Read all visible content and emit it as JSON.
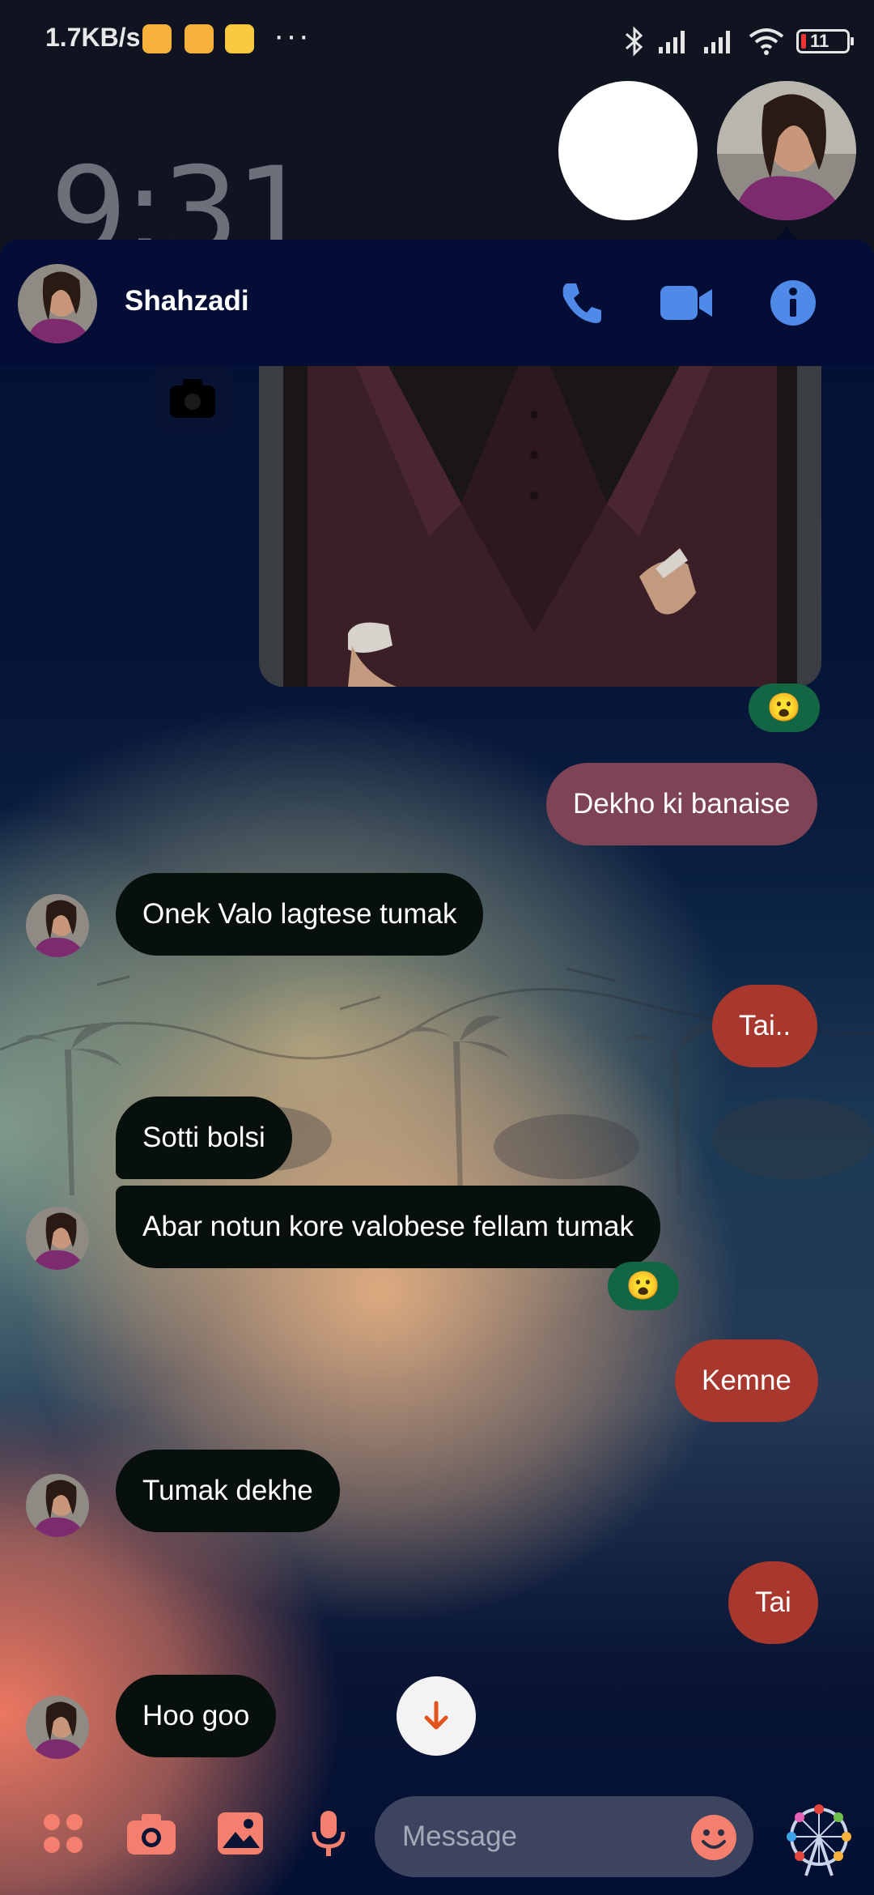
{
  "status_bar": {
    "net_speed": "1.7KB/s",
    "more": "···",
    "battery": "11"
  },
  "lock_screen": {
    "time": "9:31"
  },
  "header": {
    "contact_name": "Shahzadi",
    "icons": [
      "phone-icon",
      "video-camera-icon",
      "info-icon"
    ]
  },
  "reaction_emoji": "😮",
  "messages": [
    {
      "id": "m1",
      "direction": "sent",
      "text": "Dekho ki banaise"
    },
    {
      "id": "m2",
      "direction": "received",
      "text": "Onek Valo lagtese tumak"
    },
    {
      "id": "m3",
      "direction": "sent",
      "text": "Tai.."
    },
    {
      "id": "m4",
      "direction": "received",
      "text": "Sotti bolsi"
    },
    {
      "id": "m5",
      "direction": "received",
      "text": "Abar notun kore valobese fellam tumak"
    },
    {
      "id": "m6",
      "direction": "sent",
      "text": "Kemne"
    },
    {
      "id": "m7",
      "direction": "received",
      "text": "Tumak dekhe"
    },
    {
      "id": "m8",
      "direction": "sent",
      "text": "Tai"
    },
    {
      "id": "m9",
      "direction": "received",
      "text": "Hoo goo"
    }
  ],
  "composer": {
    "placeholder": "Message",
    "icons": [
      "apps-icon",
      "camera-icon",
      "gallery-icon",
      "microphone-icon",
      "emoji-icon",
      "ferris-wheel-icon"
    ]
  },
  "colors": {
    "accent": "#4f8ae8",
    "header_bg": "#030d35",
    "composer_icon": "#f47f6e",
    "sent_bubble": "#a8372d",
    "sent_bubble_alt": "#7e4455",
    "received_bubble": "#07100d",
    "reaction_bg": "#136644"
  }
}
